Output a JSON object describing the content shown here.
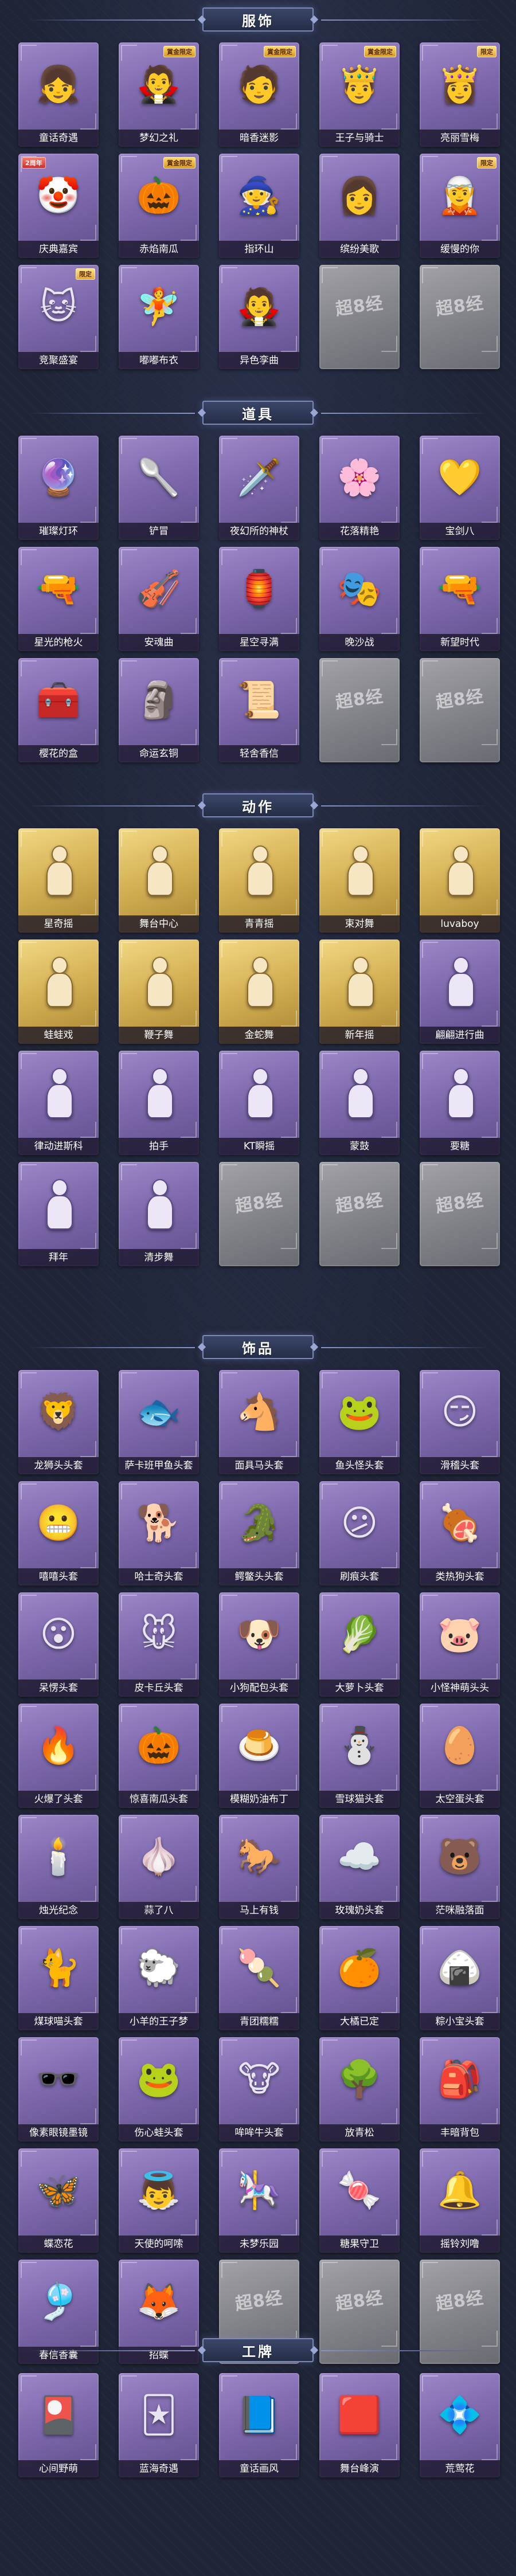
{
  "sections": [
    {
      "title": "服饰",
      "items": [
        {
          "name": "童话奇遇",
          "icon": "👧",
          "badge": ""
        },
        {
          "name": "梦幻之礼",
          "icon": "🧛",
          "badge": "賞金限定"
        },
        {
          "name": "暗香迷影",
          "icon": "🧑",
          "badge": "賞金限定"
        },
        {
          "name": "王子与骑士",
          "icon": "🤴",
          "badge": "賞金限定"
        },
        {
          "name": "亮丽雪梅",
          "icon": "👸",
          "badge": "限定"
        },
        {
          "name": "庆典嘉宾",
          "icon": "🤡",
          "badge": "",
          "anniv": "2周年"
        },
        {
          "name": "赤焰南瓜",
          "icon": "🎃",
          "badge": "賞金限定"
        },
        {
          "name": "指环山",
          "icon": "🧙",
          "badge": ""
        },
        {
          "name": "缤纷美歌",
          "icon": "👩",
          "badge": ""
        },
        {
          "name": "缓慢的你",
          "icon": "🧝",
          "badge": "限定"
        },
        {
          "name": "竞聚盛宴",
          "icon": "🐱",
          "badge": "限定"
        },
        {
          "name": "嘟嘟布衣",
          "icon": "🧚",
          "badge": ""
        },
        {
          "name": "异色孪曲",
          "icon": "🧛",
          "badge": ""
        },
        {
          "name": "",
          "icon": "超8经",
          "badge": "",
          "empty": true
        },
        {
          "name": "",
          "icon": "超8经",
          "badge": "",
          "empty": true
        }
      ]
    },
    {
      "title": "道具",
      "items": [
        {
          "name": "璀璨灯环",
          "icon": "🔮",
          "badge": ""
        },
        {
          "name": "铲冒",
          "icon": "🥄",
          "badge": ""
        },
        {
          "name": "夜幻所的神杖",
          "icon": "🗡️",
          "badge": ""
        },
        {
          "name": "花落精艳",
          "icon": "🌸",
          "badge": ""
        },
        {
          "name": "宝剑八",
          "icon": "💛",
          "badge": ""
        },
        {
          "name": "星光的枪火",
          "icon": "🔫",
          "badge": ""
        },
        {
          "name": "安魂曲",
          "icon": "🎻",
          "badge": ""
        },
        {
          "name": "星空寻满",
          "icon": "🏮",
          "badge": ""
        },
        {
          "name": "晚沙战",
          "icon": "🎭",
          "badge": ""
        },
        {
          "name": "新望时代",
          "icon": "🔫",
          "badge": ""
        },
        {
          "name": "樱花的盒",
          "icon": "🧰",
          "badge": ""
        },
        {
          "name": "命运玄铜",
          "icon": "🗿",
          "badge": ""
        },
        {
          "name": "轻舍香信",
          "icon": "📜",
          "badge": ""
        },
        {
          "name": "",
          "icon": "超8经",
          "badge": "",
          "empty": true
        },
        {
          "name": "",
          "icon": "超8经",
          "badge": "",
          "empty": true
        }
      ]
    },
    {
      "title": "动作",
      "items": [
        {
          "name": "星奇摇",
          "icon": "pose",
          "badge": "",
          "gold": true
        },
        {
          "name": "舞台中心",
          "icon": "pose",
          "badge": "",
          "gold": true
        },
        {
          "name": "青青摇",
          "icon": "pose",
          "badge": "",
          "gold": true
        },
        {
          "name": "束对舞",
          "icon": "pose",
          "badge": "",
          "gold": true
        },
        {
          "name": "luvaboy",
          "icon": "pose",
          "badge": "",
          "gold": true
        },
        {
          "name": "蛙蛙戏",
          "icon": "pose",
          "badge": "",
          "gold": true
        },
        {
          "name": "鞭子舞",
          "icon": "pose",
          "badge": "",
          "gold": true
        },
        {
          "name": "金蛇舞",
          "icon": "pose",
          "badge": "",
          "gold": true
        },
        {
          "name": "新年摇",
          "icon": "pose",
          "badge": "",
          "gold": true
        },
        {
          "name": "翩翩进行曲",
          "icon": "pose",
          "badge": ""
        },
        {
          "name": "律动进斯科",
          "icon": "pose",
          "badge": ""
        },
        {
          "name": "拍手",
          "icon": "pose",
          "badge": ""
        },
        {
          "name": "KT瞬摇",
          "icon": "pose",
          "badge": ""
        },
        {
          "name": "蒙鼓",
          "icon": "pose",
          "badge": ""
        },
        {
          "name": "要糖",
          "icon": "pose",
          "badge": ""
        },
        {
          "name": "拜年",
          "icon": "pose",
          "badge": ""
        },
        {
          "name": "清步舞",
          "icon": "pose",
          "badge": ""
        },
        {
          "name": "",
          "icon": "超8经",
          "badge": "",
          "empty": true
        },
        {
          "name": "",
          "icon": "超8经",
          "badge": "",
          "empty": true
        },
        {
          "name": "",
          "icon": "超8经",
          "badge": "",
          "empty": true
        }
      ]
    },
    {
      "title": "饰品",
      "items": [
        {
          "name": "龙狮头头套",
          "icon": "🦁",
          "badge": ""
        },
        {
          "name": "萨卡班甲鱼头套",
          "icon": "🐟",
          "badge": ""
        },
        {
          "name": "面具马头套",
          "icon": "🐴",
          "badge": ""
        },
        {
          "name": "鱼头怪头套",
          "icon": "🐸",
          "badge": ""
        },
        {
          "name": "滑稽头套",
          "icon": "😏",
          "badge": ""
        },
        {
          "name": "嘻嘻头套",
          "icon": "😬",
          "badge": ""
        },
        {
          "name": "哈士奇头套",
          "icon": "🐕",
          "badge": ""
        },
        {
          "name": "鳄鳖头头套",
          "icon": "🐊",
          "badge": ""
        },
        {
          "name": "刷痕头套",
          "icon": "😕",
          "badge": ""
        },
        {
          "name": "类热狗头套",
          "icon": "🍖",
          "badge": ""
        },
        {
          "name": "呆愣头套",
          "icon": "😮",
          "badge": ""
        },
        {
          "name": "皮卡丘头套",
          "icon": "🐭",
          "badge": ""
        },
        {
          "name": "小狗配包头套",
          "icon": "🐶",
          "badge": ""
        },
        {
          "name": "大萝卜头套",
          "icon": "🥬",
          "badge": ""
        },
        {
          "name": "小怪神萌头头",
          "icon": "🐷",
          "badge": ""
        },
        {
          "name": "火爆了头套",
          "icon": "🔥",
          "badge": ""
        },
        {
          "name": "惊喜南瓜头套",
          "icon": "🎃",
          "badge": ""
        },
        {
          "name": "模糊奶油布丁",
          "icon": "🍮",
          "badge": ""
        },
        {
          "name": "雪球猫头套",
          "icon": "⛄",
          "badge": ""
        },
        {
          "name": "太空蛋头套",
          "icon": "🥚",
          "badge": ""
        },
        {
          "name": "烛光纪念",
          "icon": "🕯️",
          "badge": ""
        },
        {
          "name": "蒜了八",
          "icon": "🧄",
          "badge": ""
        },
        {
          "name": "马上有钱",
          "icon": "🐎",
          "badge": ""
        },
        {
          "name": "玫瑰奶头套",
          "icon": "☁️",
          "badge": ""
        },
        {
          "name": "茫咪融落面",
          "icon": "🐻",
          "badge": ""
        },
        {
          "name": "煤球喵头套",
          "icon": "🐈",
          "badge": ""
        },
        {
          "name": "小羊的王子梦",
          "icon": "🐑",
          "badge": ""
        },
        {
          "name": "青团糯糯",
          "icon": "🍡",
          "badge": ""
        },
        {
          "name": "大橘已定",
          "icon": "🍊",
          "badge": ""
        },
        {
          "name": "粽小宝头套",
          "icon": "🍙",
          "badge": ""
        },
        {
          "name": "像素眼镜墨镜",
          "icon": "🕶️",
          "badge": ""
        },
        {
          "name": "伤心蛙头套",
          "icon": "🐸",
          "badge": ""
        },
        {
          "name": "哞哞牛头套",
          "icon": "🐮",
          "badge": ""
        },
        {
          "name": "放青松",
          "icon": "🌳",
          "badge": ""
        },
        {
          "name": "丰暗背包",
          "icon": "🎒",
          "badge": ""
        },
        {
          "name": "蝶恋花",
          "icon": "🦋",
          "badge": ""
        },
        {
          "name": "天使的呵嗦",
          "icon": "👼",
          "badge": ""
        },
        {
          "name": "未梦乐园",
          "icon": "🎠",
          "badge": ""
        },
        {
          "name": "糖果守卫",
          "icon": "🍬",
          "badge": ""
        },
        {
          "name": "摇铃刘噜",
          "icon": "🔔",
          "badge": ""
        },
        {
          "name": "春信香囊",
          "icon": "🎐",
          "badge": ""
        },
        {
          "name": "招蝶",
          "icon": "🦊",
          "badge": ""
        },
        {
          "name": "",
          "icon": "超8经",
          "badge": "",
          "empty": true
        },
        {
          "name": "",
          "icon": "超8经",
          "badge": "",
          "empty": true
        },
        {
          "name": "",
          "icon": "超8经",
          "badge": "",
          "empty": true
        }
      ]
    },
    {
      "title": "工牌",
      "items": [
        {
          "name": "心间野萌",
          "icon": "🎴",
          "badge": ""
        },
        {
          "name": "蓝海奇遇",
          "icon": "🃏",
          "badge": ""
        },
        {
          "name": "童话画风",
          "icon": "📘",
          "badge": ""
        },
        {
          "name": "舞台峰演",
          "icon": "🟥",
          "badge": ""
        },
        {
          "name": "荒莺花",
          "icon": "💠",
          "badge": ""
        }
      ]
    }
  ]
}
